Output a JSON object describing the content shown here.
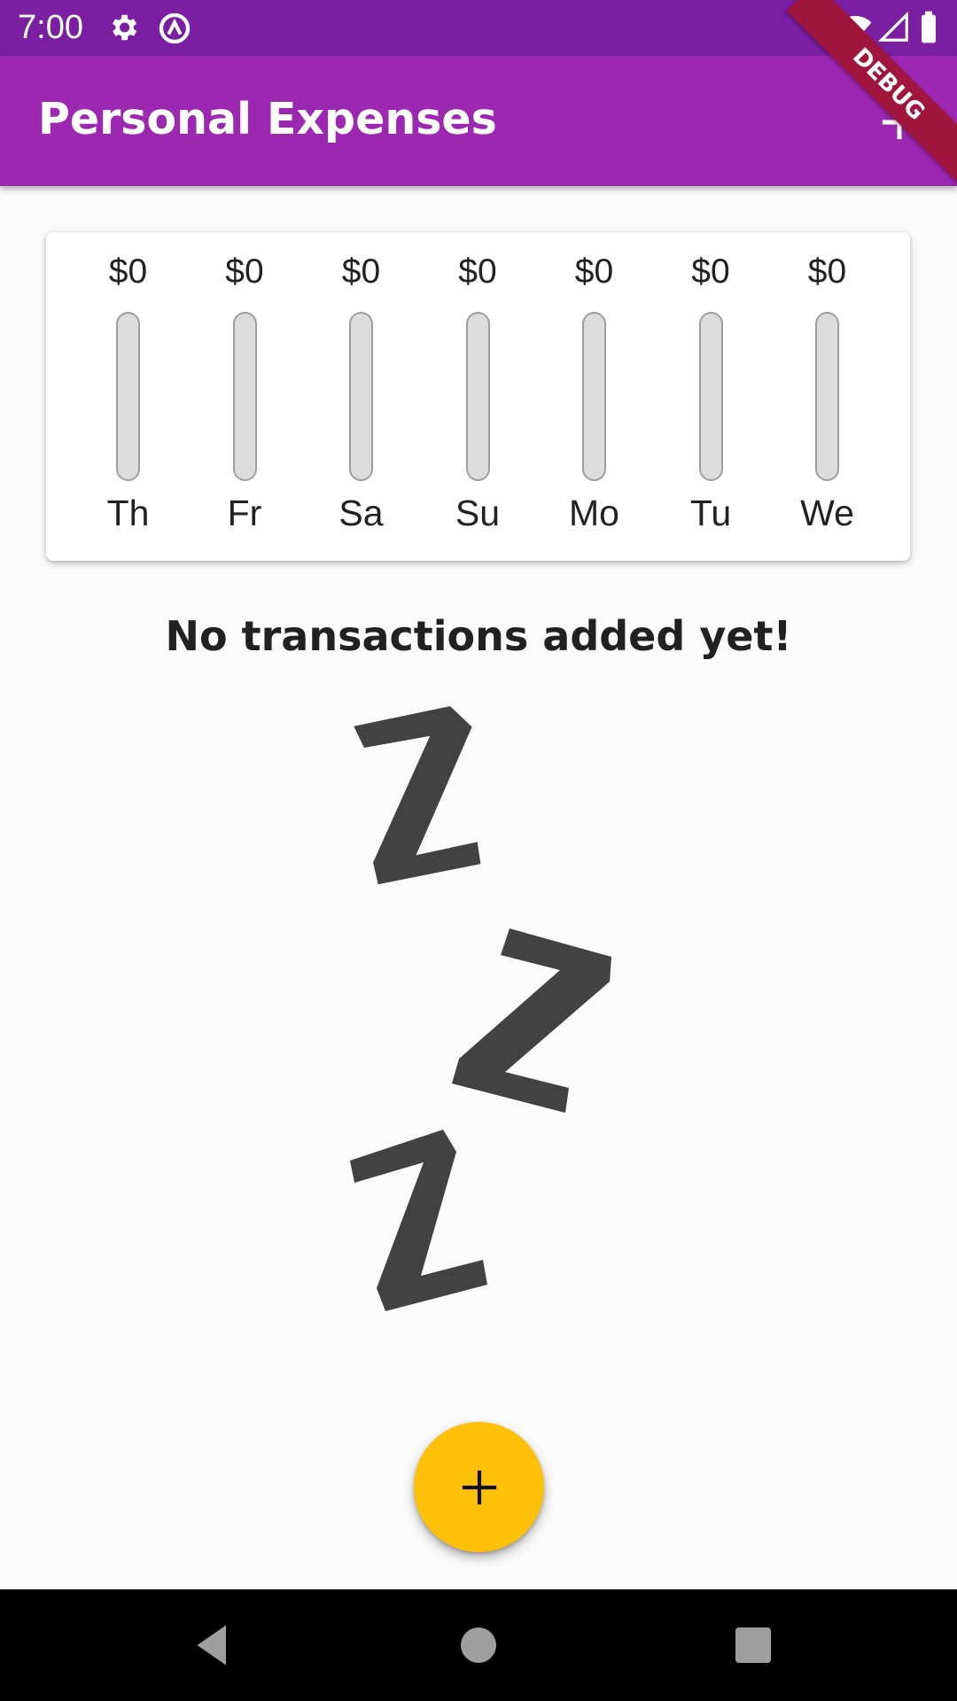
{
  "status_bar": {
    "time": "7:00",
    "icons": [
      "gear-icon",
      "data-saver-icon",
      "wifi-icon",
      "signal-icon",
      "battery-icon"
    ]
  },
  "debug_banner": {
    "label": "DEBUG"
  },
  "app_bar": {
    "title": "Personal Expenses",
    "action_icon": "add-icon",
    "color": "#9c27b0"
  },
  "chart": {
    "bars": [
      {
        "amount": "$0",
        "day": "Th",
        "fraction": 0
      },
      {
        "amount": "$0",
        "day": "Fr",
        "fraction": 0
      },
      {
        "amount": "$0",
        "day": "Sa",
        "fraction": 0
      },
      {
        "amount": "$0",
        "day": "Su",
        "fraction": 0
      },
      {
        "amount": "$0",
        "day": "Mo",
        "fraction": 0
      },
      {
        "amount": "$0",
        "day": "Tu",
        "fraction": 0
      },
      {
        "amount": "$0",
        "day": "We",
        "fraction": 0
      }
    ]
  },
  "empty_state": {
    "title": "No transactions added yet!",
    "image_icon": "sleeping-zzz-icon"
  },
  "fab": {
    "icon": "add-icon",
    "color": "#ffc107"
  },
  "nav_bar": {
    "icons": [
      "back-icon",
      "home-icon",
      "recents-icon"
    ]
  }
}
